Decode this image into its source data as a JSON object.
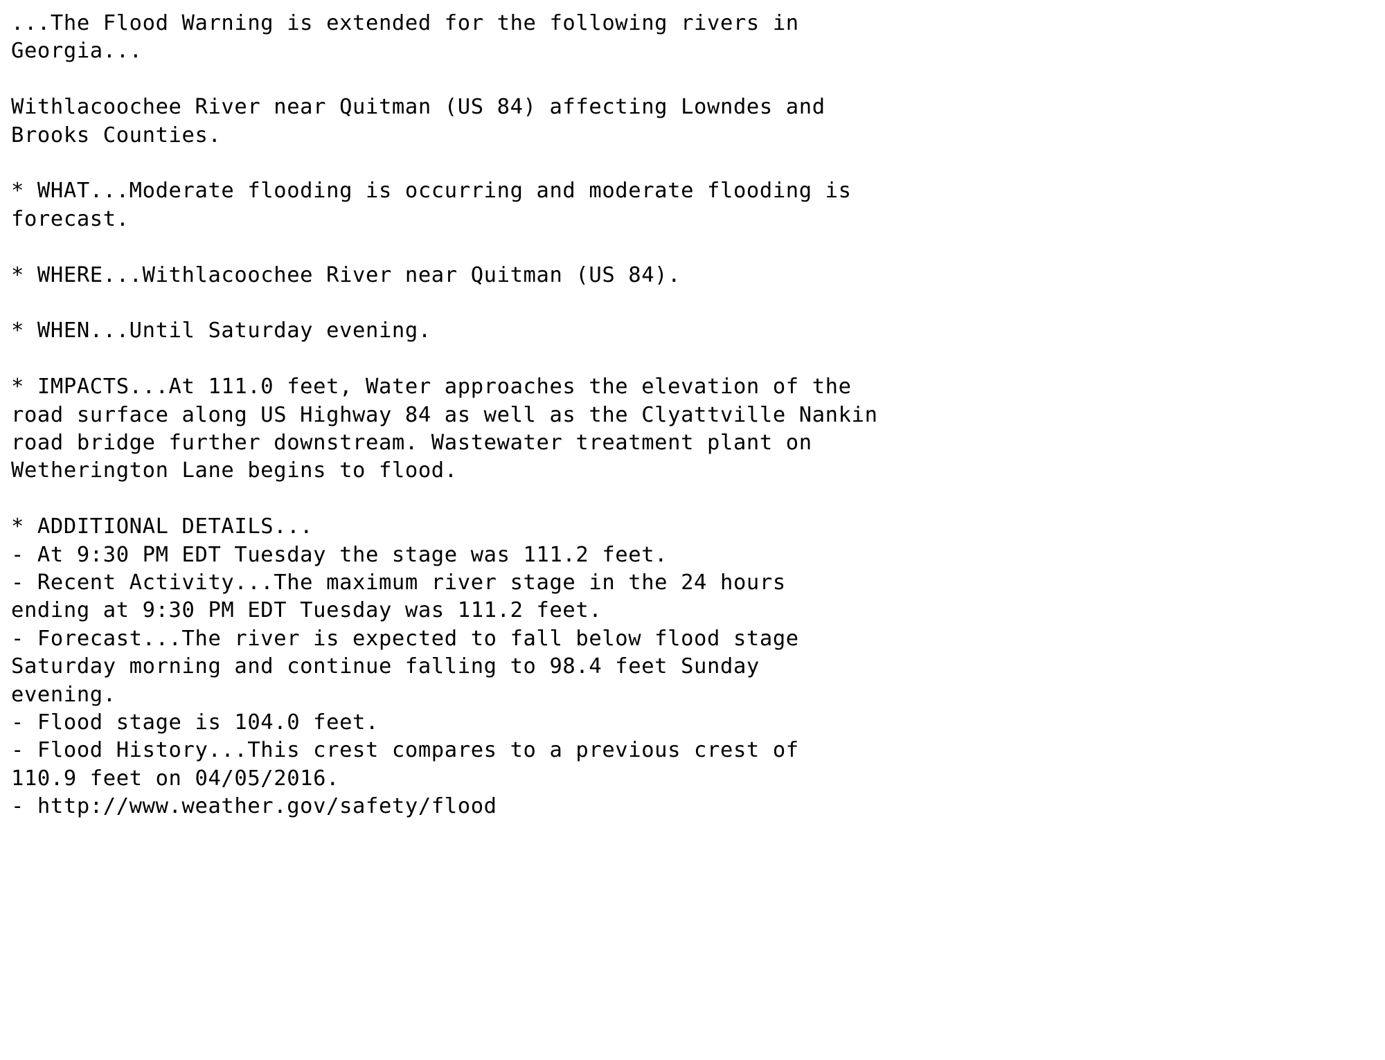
{
  "document": {
    "type": "nws-flood-warning-bulletin",
    "background_color": "#ffffff",
    "text_color": "#000000",
    "headline": "...The Flood Warning is extended for the following rivers in Georgia...",
    "river_segment": "Withlacoochee River near Quitman (US 84) affecting Lowndes and Brooks Counties.",
    "sections": {
      "what": "* WHAT...Moderate flooding is occurring and moderate flooding is forecast.",
      "where": "* WHERE...Withlacoochee River near Quitman (US 84).",
      "when": "* WHEN...Until Saturday evening.",
      "impacts": "* IMPACTS...At 111.0 feet, Water approaches the elevation of the road surface along US Highway 84 as well as the Clyattville Nankin road bridge further downstream. Wastewater treatment plant on Wetherington Lane begins to flood.",
      "additional_details_header": "* ADDITIONAL DETAILS..."
    },
    "additional_details": [
      "- At 9:30 PM EDT Tuesday the stage was 111.2 feet.",
      "- Recent Activity...The maximum river stage in the 24 hours ending at 9:30 PM EDT Tuesday was 111.2 feet.",
      "- Forecast...The river is expected to fall below flood stage Saturday morning and continue falling to 98.4 feet Sunday evening.",
      "- Flood stage is 104.0 feet.",
      "- Flood History...This crest compares to a previous crest of 110.9 feet on 04/05/2016.",
      "- http://www.weather.gov/safety/flood"
    ],
    "values": {
      "impact_stage_feet": "111.0",
      "current_stage_feet": "111.2",
      "max_stage_24h_feet": "111.2",
      "forecast_fall_to_feet": "98.4",
      "flood_stage_feet": "104.0",
      "previous_crest_feet": "110.9",
      "previous_crest_date": "04/05/2016",
      "observation_time": "9:30 PM EDT Tuesday",
      "highway": "US Highway 84",
      "route_marker": "US 84",
      "counties": "Lowndes and Brooks Counties",
      "river_name": "Withlacoochee River",
      "location": "near Quitman",
      "state": "Georgia",
      "bridge": "Clyattville Nankin road bridge",
      "facility": "Wastewater treatment plant on Wetherington Lane",
      "url": "http://www.weather.gov/safety/flood"
    },
    "lines": [
      "...The Flood Warning is extended for the following rivers in",
      "Georgia...",
      "",
      "Withlacoochee River near Quitman (US 84) affecting Lowndes and",
      "Brooks Counties.",
      "",
      "* WHAT...Moderate flooding is occurring and moderate flooding is",
      "forecast.",
      "",
      "* WHERE...Withlacoochee River near Quitman (US 84).",
      "",
      "* WHEN...Until Saturday evening.",
      "",
      "* IMPACTS...At 111.0 feet, Water approaches the elevation of the",
      "road surface along US Highway 84 as well as the Clyattville Nankin",
      "road bridge further downstream. Wastewater treatment plant on",
      "Wetherington Lane begins to flood.",
      "",
      "* ADDITIONAL DETAILS...",
      "- At 9:30 PM EDT Tuesday the stage was 111.2 feet.",
      "- Recent Activity...The maximum river stage in the 24 hours",
      "ending at 9:30 PM EDT Tuesday was 111.2 feet.",
      "- Forecast...The river is expected to fall below flood stage",
      "Saturday morning and continue falling to 98.4 feet Sunday",
      "evening.",
      "- Flood stage is 104.0 feet.",
      "- Flood History...This crest compares to a previous crest of",
      "110.9 feet on 04/05/2016.",
      "- http://www.weather.gov/safety/flood"
    ]
  }
}
